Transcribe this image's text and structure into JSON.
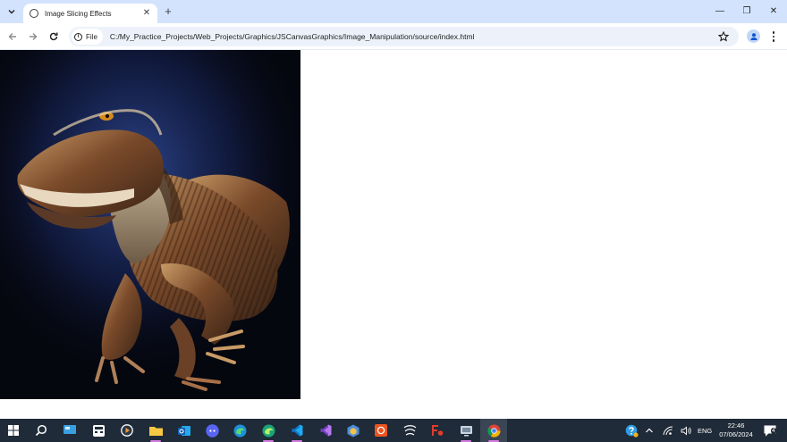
{
  "browser": {
    "tab": {
      "title": "Image Slicing Effects",
      "close_glyph": "✕"
    },
    "new_tab_glyph": "+",
    "window_controls": {
      "minimize": "—",
      "restore": "❐",
      "close": "✕"
    },
    "site_chip_label": "File",
    "url": "C:/My_Practice_Projects/Web_Projects/Graphics/JSCanvasGraphics/Image_Manipulation/source/index.html",
    "icons": [
      "tab-search-icon",
      "globe-icon",
      "back-arrow-icon",
      "forward-arrow-icon",
      "reload-icon",
      "info-icon",
      "bookmark-star-icon",
      "profile-icon",
      "menu-kebab-icon"
    ]
  },
  "page": {
    "canvas_content": "velociraptor image rendered on canvas with slicing effect",
    "canvas_background": "#05070f"
  },
  "taskbar": {
    "apps": [
      "start",
      "search",
      "file-explorer-pinned",
      "calculator",
      "media-player",
      "file-explorer",
      "outlook",
      "discord",
      "edge",
      "edge-dev",
      "vscode",
      "visual-studio",
      "app-hexagon",
      "ubuntu",
      "inkscape",
      "foxit-pdf",
      "virtualbox",
      "chrome"
    ],
    "tray": {
      "language": "ENG",
      "time": "22:46",
      "date": "07/06/2024",
      "notification_count": "4"
    }
  },
  "colors": {
    "tabstrip": "#d3e3fd",
    "omnibox": "#edf2fa",
    "taskbar": "#1f2b38",
    "accent": "#d57fe0"
  }
}
